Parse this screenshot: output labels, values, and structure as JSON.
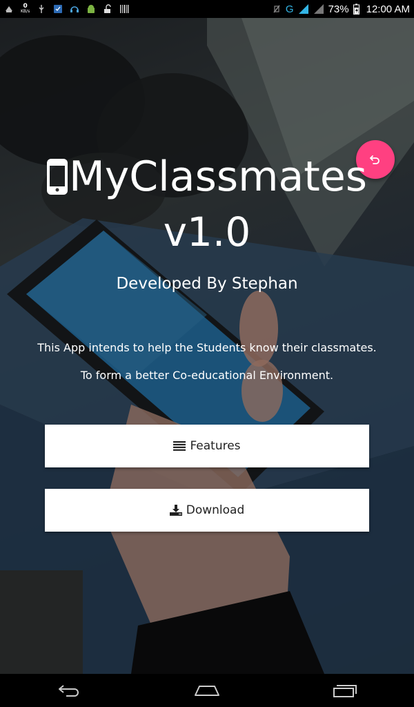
{
  "status_bar": {
    "net_speed_value": "0",
    "net_speed_unit": "KB/s",
    "network_type": "G",
    "battery_percent": "73%",
    "clock": "12:00 AM"
  },
  "app": {
    "title_line1": "MyClassmates",
    "title_line2": "v1.0",
    "developer": "Developed By Stephan",
    "description_line1": "This App intends to help the Students know their classmates.",
    "description_line2": "To form a better Co-educational Environment."
  },
  "buttons": {
    "features_label": "Features",
    "download_label": "Download"
  },
  "icons": {
    "title_icon": "mobile-phone-icon",
    "fab_icon": "undo-icon",
    "features_icon": "list-icon",
    "download_icon": "download-icon"
  },
  "colors": {
    "accent": "#ff4081",
    "button_bg": "#ffffff",
    "text_light": "#ffffff"
  }
}
